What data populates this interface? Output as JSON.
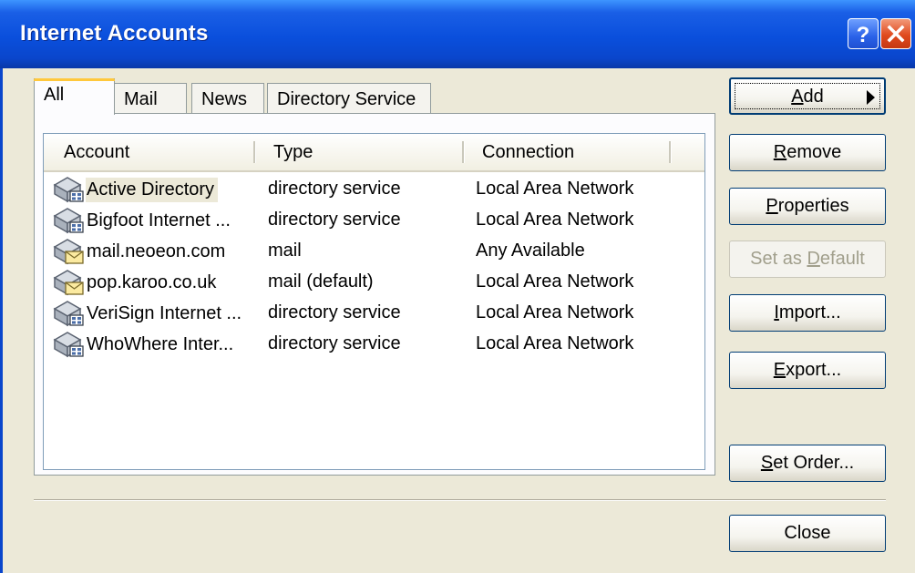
{
  "window": {
    "title": "Internet Accounts"
  },
  "titlebar_buttons": [
    "help-icon",
    "close-icon"
  ],
  "tabs": [
    {
      "label": "All",
      "active": true
    },
    {
      "label": "Mail",
      "active": false
    },
    {
      "label": "News",
      "active": false
    },
    {
      "label": "Directory Service",
      "active": false
    }
  ],
  "list": {
    "columns": [
      "Account",
      "Type",
      "Connection"
    ],
    "rows": [
      {
        "account": "Active Directory",
        "type": "directory service",
        "connection": "Local Area Network",
        "icon": "directory-service-icon",
        "selected": true
      },
      {
        "account": "Bigfoot Internet ...",
        "type": "directory service",
        "connection": "Local Area Network",
        "icon": "directory-service-icon"
      },
      {
        "account": "mail.neoeon.com",
        "type": "mail",
        "connection": "Any Available",
        "icon": "mail-account-icon"
      },
      {
        "account": "pop.karoo.co.uk",
        "type": "mail (default)",
        "connection": "Local Area Network",
        "icon": "mail-account-icon"
      },
      {
        "account": "VeriSign Internet ...",
        "type": "directory service",
        "connection": "Local Area Network",
        "icon": "directory-service-icon"
      },
      {
        "account": "WhoWhere Inter...",
        "type": "directory service",
        "connection": "Local Area Network",
        "icon": "directory-service-icon"
      }
    ]
  },
  "buttons": {
    "add": {
      "pre": "",
      "key": "A",
      "post": "dd"
    },
    "remove": {
      "pre": "",
      "key": "R",
      "post": "emove"
    },
    "properties": {
      "pre": "",
      "key": "P",
      "post": "roperties"
    },
    "set_default": {
      "pre": "Set as ",
      "key": "D",
      "post": "efault"
    },
    "import": {
      "pre": "",
      "key": "I",
      "post": "mport..."
    },
    "export": {
      "pre": "",
      "key": "E",
      "post": "xport..."
    },
    "set_order": {
      "pre": "",
      "key": "S",
      "post": "et Order..."
    },
    "close": {
      "label": "Close"
    }
  },
  "colors": {
    "titlebar": "#0a46cc",
    "dialog": "#ece9d8",
    "tab_highlight": "#ffc83c",
    "selection": "#ece9d8"
  }
}
